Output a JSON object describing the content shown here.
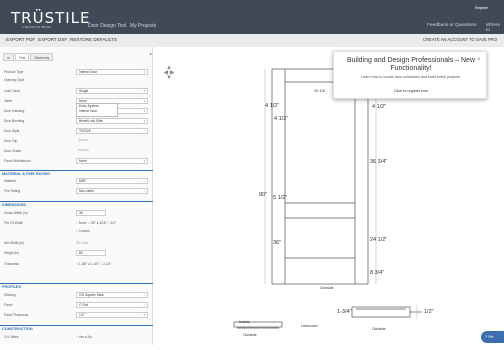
{
  "brand": {
    "name": "TRÜSTILE",
    "sub": "A MASONITE BRAND"
  },
  "nav": {
    "door_design": "Door Design Tool",
    "projects": "My Projects",
    "feedback": "Feedback or Questions",
    "where": "Where to",
    "register": "Register"
  },
  "toolbar": {
    "export_pdf": "EXPORT PDF",
    "export_dxf": "EXPORT DXF",
    "restore": "RESTORE DEFAULTS",
    "create_account": "CREATE AN ACCOUNT TO SAVE PRO"
  },
  "tabs": [
    "m",
    "Fhst",
    "Martinney"
  ],
  "fields": [
    {
      "label": "Product Type",
      "value": "Interior Door"
    },
    {
      "label": "Opening Type",
      "value": "Entry System"
    },
    {
      "label": "Leaf Count",
      "value": "Single"
    },
    {
      "label": "Jamb",
      "value": "None"
    },
    {
      "label": "Door Handing",
      "value": "Unknown Handing"
    },
    {
      "label": "Door Bonding",
      "value": "Bevel/Lock Side"
    },
    {
      "label": "Door Style",
      "value": "TS2026"
    },
    {
      "label": "Door Top",
      "value": "Square"
    },
    {
      "label": "Door Grade",
      "value": "Natural"
    },
    {
      "label": "Panel Substitution",
      "value": "None"
    }
  ],
  "dropdown_options": [
    "Entry System",
    "Interior Door"
  ],
  "sections": {
    "material": "MATERIAL & FIRE RATING",
    "dimensions": "DIMENSIONS",
    "profiles": "PROFILES",
    "construction": "CONSTRUCTION"
  },
  "material_fields": [
    {
      "label": "Material",
      "value": "MDF"
    },
    {
      "label": "Fire Rating",
      "value": "Non-rated"
    }
  ],
  "dim_fields": {
    "width_label": "Gross Width (in)",
    "width_value": "36",
    "prefit_label": "Pre-Fit Width",
    "prefit_options": "○ None ○ 1/8\" ● 3/16\" ○ 1/4\"",
    "custom": "○ Custom",
    "net_label": "Net Width (in)",
    "net_value": "35 13/16",
    "height_label": "Height (in)",
    "height_value": "80",
    "thick_label": "Thickness",
    "thick_options": "○ 1-3/8\" ● 1-3/4\" ○ 2-1/4\""
  },
  "profile_fields": [
    {
      "label": "Sticking",
      "value": "OG Square Stick"
    },
    {
      "label": "Panel",
      "value": "C Flat"
    },
    {
      "label": "Panel Thickness",
      "value": "1/2\""
    }
  ],
  "construction": {
    "label": "LVL Stiles",
    "options": "○ Yes ● No"
  },
  "popup": {
    "title": "Building and Design Professionals – New Functionality!",
    "text": "Learn how to create door schedules and build entire projects.",
    "link": "Click to register now"
  },
  "dims": {
    "top_width": "20 13/",
    "stile_l": "4 1/2\"",
    "stile_r": "4 1/2\"",
    "top_rail": "4 1/2\"",
    "upper_panel": "36 3/4\"",
    "overall": "80\"",
    "lock_rail": "5 1/2\"",
    "lower_left": "36\"",
    "lower_panel": "24 1/2\"",
    "bottom_rail": "8 3/4\"",
    "outside": "Outside",
    "thick": "1-3/4\"",
    "panel_t": "1/2\"",
    "outside2": "Outside",
    "inside": "Inside",
    "unknown": "Unknown",
    "outside3": "Outside"
  },
  "help": "Re"
}
